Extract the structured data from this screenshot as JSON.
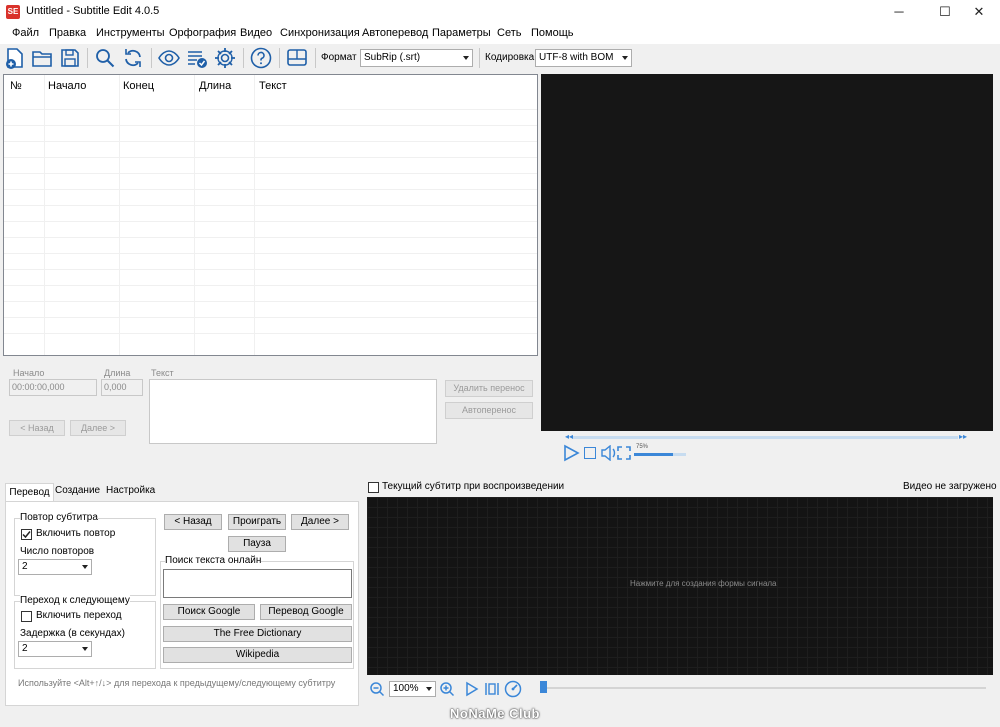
{
  "window": {
    "title": "Untitled - Subtitle Edit 4.0.5",
    "app_icon_text": "SE",
    "minimize_glyph": "─",
    "maximize_glyph": "☐",
    "close_glyph": "✕"
  },
  "menu": [
    "Файл",
    "Правка",
    "Инструменты",
    "Орфография",
    "Видео",
    "Синхронизация",
    "Автоперевод",
    "Параметры",
    "Сеть",
    "Помощь"
  ],
  "toolbar": {
    "icons": [
      "new-file-icon",
      "open-folder-icon",
      "save-icon",
      "find-icon",
      "replace-icon",
      "visual-sync-icon",
      "spell-check-icon",
      "settings-icon",
      "help-icon",
      "layout-icon"
    ],
    "format_label": "Формат",
    "format_value": "SubRip (.srt)",
    "encoding_label": "Кодировка",
    "encoding_value": "UTF-8 with BOM"
  },
  "subtitle_list": {
    "columns": [
      "№",
      "Начало",
      "Конец",
      "Длина",
      "Текст"
    ]
  },
  "editor": {
    "start_label": "Начало",
    "start_value": "00:00:00,000",
    "duration_label": "Длина",
    "duration_value": "0,000",
    "text_label": "Текст",
    "prev_button": "< Назад",
    "next_button": "Далее >",
    "remove_linebreak_button": "Удалить перенос",
    "auto_linebreak_button": "Автоперенос"
  },
  "video_controls": {
    "volume_percent": "75%",
    "volume_level": 0.75
  },
  "bottom_tabs": [
    "Перевод",
    "Создание",
    "Настройка"
  ],
  "translate_tab": {
    "repeat_group": "Повтор субтитра",
    "enable_repeat": "Включить повтор",
    "enable_repeat_checked": true,
    "repeat_count_label": "Число повторов",
    "repeat_count_value": "2",
    "next_group": "Переход к следующему",
    "enable_next": "Включить переход",
    "enable_next_checked": false,
    "delay_label": "Задержка (в секундах)",
    "delay_value": "2",
    "prev_button": "< Назад",
    "play_button": "Проиграть",
    "next_button": "Далее >",
    "pause_button": "Пауза",
    "search_label": "Поиск текста онлайн",
    "google_search_button": "Поиск Google",
    "google_translate_button": "Перевод Google",
    "free_dictionary_button": "The Free Dictionary",
    "wikipedia_button": "Wikipedia",
    "hint": "Используйте <Alt+↑/↓> для перехода к предыдущему/следующему субтитру"
  },
  "waveform": {
    "current_subtitle_checkbox": "Текущий субтитр при воспроизведении",
    "video_status": "Видео не загружено",
    "placeholder": "Нажмите для создания формы сигнала",
    "zoom_value": "100%"
  },
  "watermark": "NoNaMe Club"
}
